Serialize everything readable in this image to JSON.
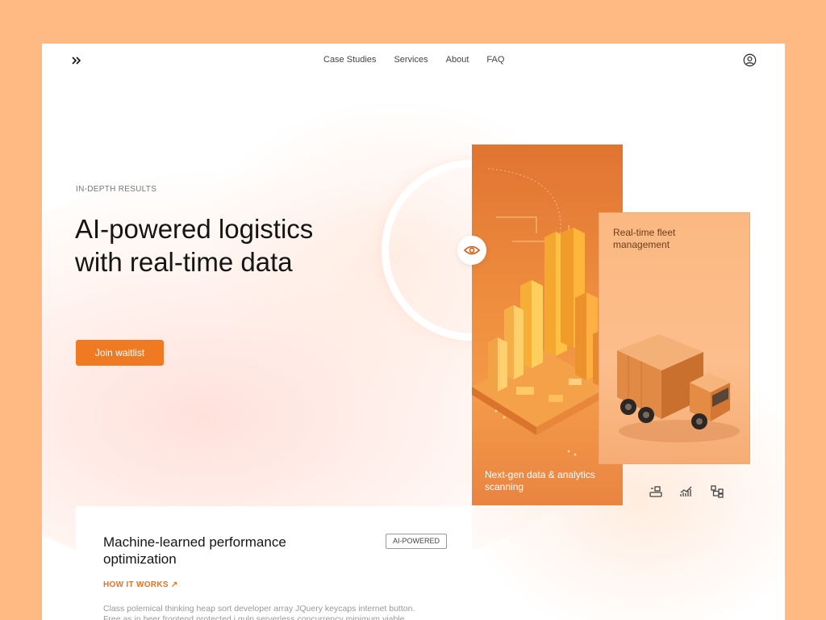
{
  "nav": {
    "items": [
      "Case Studies",
      "Services",
      "About",
      "FAQ"
    ]
  },
  "hero": {
    "eyebrow": "IN-DEPTH RESULTS",
    "title": "AI-powered logistics with real-time data",
    "cta_label": "Join waitlist"
  },
  "cards": {
    "data_card_label": "Next-gen data & analytics scanning",
    "fleet_card_title": "Real-time fleet management"
  },
  "feature": {
    "title": "Machine-learned performance optimization",
    "badge": "AI-POWERED",
    "link_label": "HOW IT WORKS ↗",
    "body": "Class polemical thinking heap sort developer array JQuery keycaps internet button. Free as in beer frontend protected i gulp serverless concurrency minimum viable"
  },
  "colors": {
    "page_background": "#ffb983",
    "accent": "#f07a22",
    "data_card": "#ef8e3e",
    "fleet_card": "#fcbe8c"
  },
  "icons": [
    "chevrons-right-icon",
    "user-icon",
    "eye-icon",
    "scanner-icon",
    "chart-icon",
    "hierarchy-icon"
  ]
}
